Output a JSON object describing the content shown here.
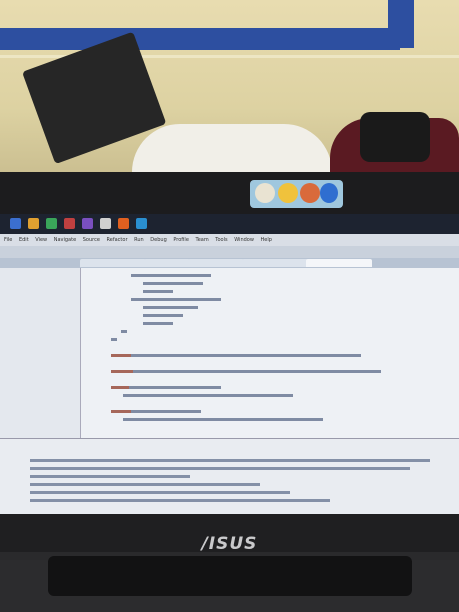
{
  "laptop": {
    "brand_logo": "/ISUS"
  },
  "ide": {
    "menu": [
      "File",
      "Edit",
      "View",
      "Navigate",
      "Source",
      "Refactor",
      "Run",
      "Debug",
      "Profile",
      "Team",
      "Tools",
      "Window",
      "Help"
    ],
    "tabs": [
      "",
      "",
      "",
      "",
      ""
    ],
    "tree_items": [
      "",
      "",
      "",
      "",
      "",
      "",
      "",
      "",
      "",
      "",
      "",
      "",
      "",
      "",
      "",
      "",
      "",
      "",
      ""
    ],
    "code_lines": [
      "",
      "",
      "",
      "",
      "",
      "",
      "",
      "",
      "",
      "",
      "",
      "",
      "",
      "",
      "",
      "",
      "",
      "",
      ""
    ],
    "output_lines": [
      "",
      "",
      "",
      "",
      "",
      "",
      "",
      ""
    ]
  },
  "colors": {
    "screen_bg": "#cfd6df",
    "taskbar": "#1d2330",
    "wall": "#e8dcb0",
    "wall_stripe": "#2d4fa0"
  }
}
